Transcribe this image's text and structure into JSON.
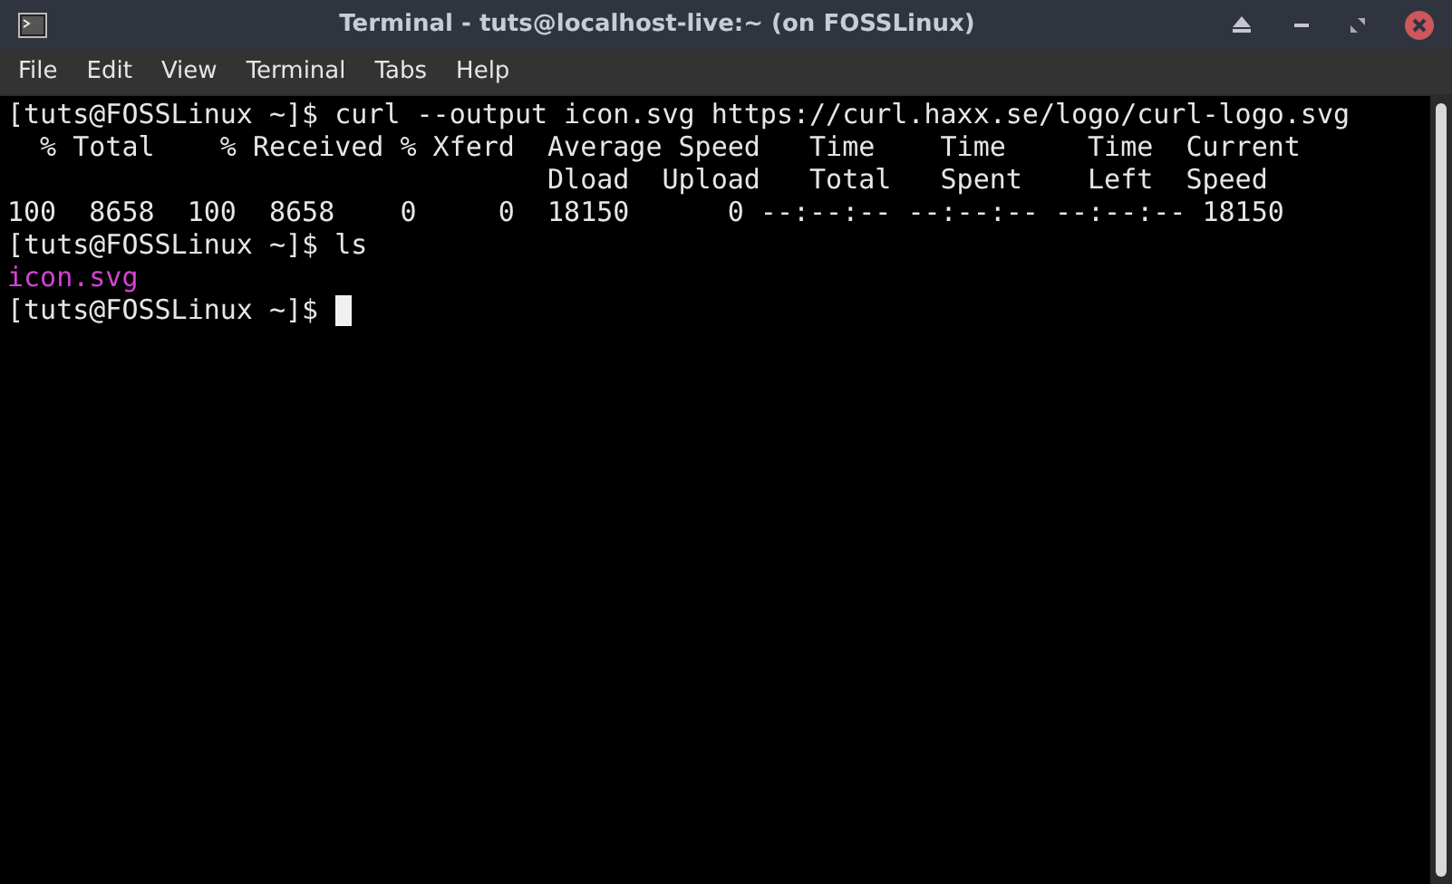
{
  "window": {
    "title": "Terminal - tuts@localhost-live:~ (on FOSSLinux)"
  },
  "menu": [
    "File",
    "Edit",
    "View",
    "Terminal",
    "Tabs",
    "Help"
  ],
  "terminal": {
    "lines": [
      {
        "text": "[tuts@FOSSLinux ~]$ curl --output icon.svg https://curl.haxx.se/logo/curl-logo.svg",
        "color": "#e6e6e6",
        "cursor": false
      },
      {
        "text": "  % Total    % Received % Xferd  Average Speed   Time    Time     Time  Current",
        "color": "#e6e6e6",
        "cursor": false
      },
      {
        "text": "                                 Dload  Upload   Total   Spent    Left  Speed",
        "color": "#e6e6e6",
        "cursor": false
      },
      {
        "text": "100  8658  100  8658    0     0  18150      0 --:--:-- --:--:-- --:--:-- 18150",
        "color": "#e6e6e6",
        "cursor": false
      },
      {
        "text": "[tuts@FOSSLinux ~]$ ls",
        "color": "#e6e6e6",
        "cursor": false
      },
      {
        "text": "icon.svg",
        "color": "#d442d4",
        "cursor": false
      },
      {
        "text": "[tuts@FOSSLinux ~]$ ",
        "color": "#e6e6e6",
        "cursor": true
      }
    ]
  }
}
